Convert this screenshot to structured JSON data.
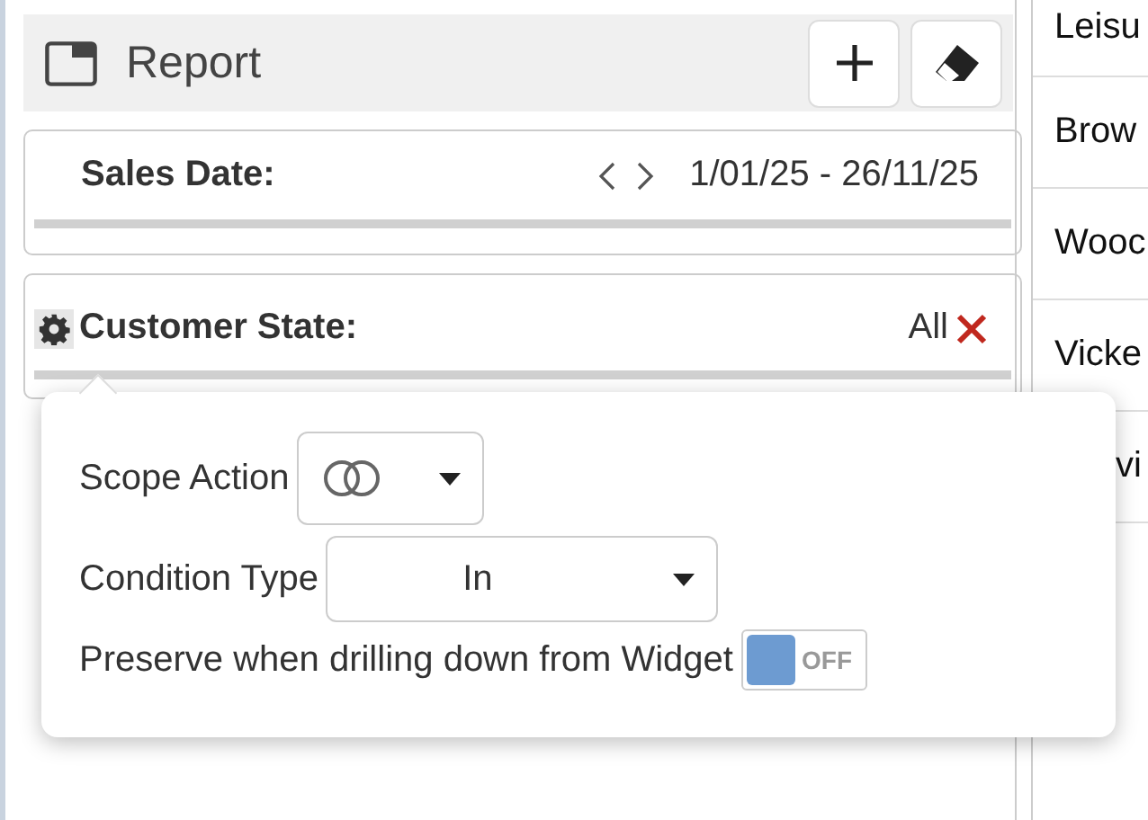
{
  "report_header": {
    "title": "Report",
    "buttons": [
      {
        "kind": "add"
      },
      {
        "kind": "erase"
      }
    ]
  },
  "filters": [
    {
      "kind": "date",
      "label": "Sales Date:",
      "value": "1/01/25 - 26/11/25"
    },
    {
      "kind": "choice",
      "label": "Customer State:",
      "value": "All"
    }
  ],
  "popover": {
    "scope_action": {
      "label": "Scope Action"
    },
    "condition_type": {
      "label": "Condition Type",
      "value": "In"
    },
    "preserve": {
      "label": "Preserve when drilling down from Widget",
      "on": false,
      "toggle_text": "OFF"
    }
  },
  "side_table": {
    "rows": [
      "Leisu",
      "Brow",
      "Wooc",
      "Vicke",
      "vi"
    ]
  }
}
